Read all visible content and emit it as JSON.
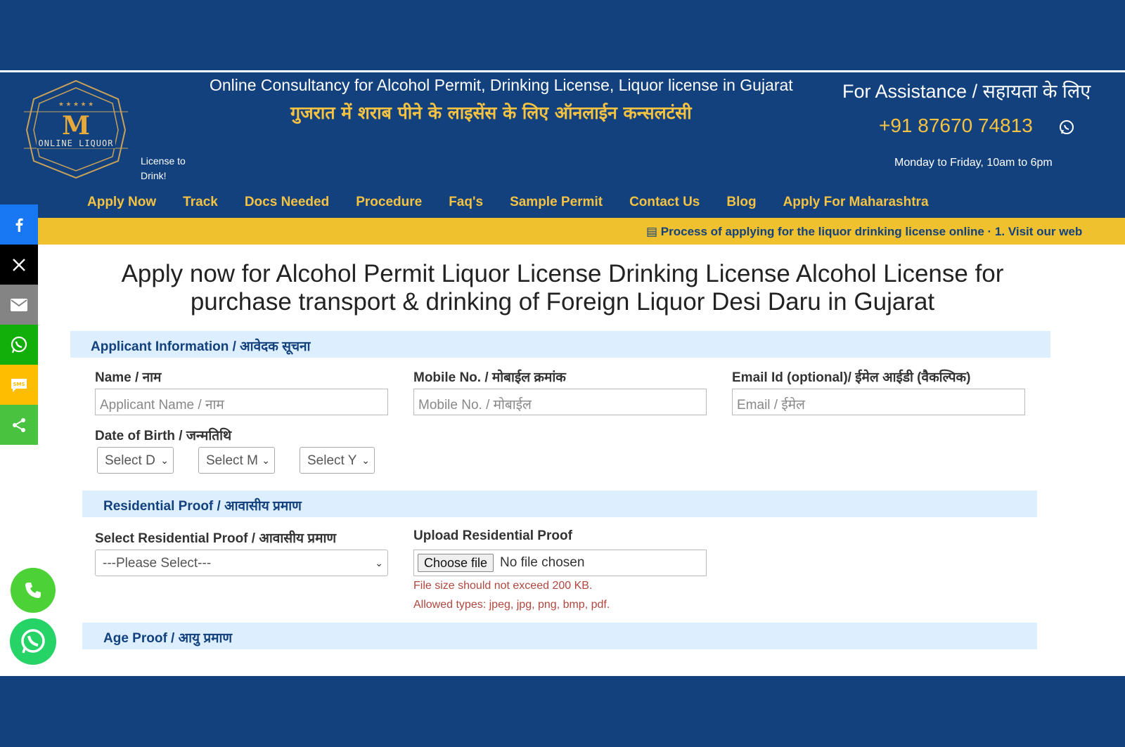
{
  "header": {
    "logo_text": "ONLINE LIQUOR",
    "logo_tagline": "License to Drink!",
    "tagline_en": "Online Consultancy for Alcohol Permit, Drinking License, Liquor license in Gujarat",
    "tagline_hi": "गुजरात में शराब पीने के लाइसेंस के लिए ऑनलाईन कन्सलटंसी",
    "assist_title": "For Assistance / सहायता के लिए",
    "assist_phone": "+91 87670 74813",
    "assist_hours": "Monday to Friday, 10am to 6pm"
  },
  "nav": {
    "items": [
      "Apply Now",
      "Track",
      "Docs Needed",
      "Procedure",
      "Faq's",
      "Sample Permit",
      "Contact Us",
      "Blog",
      "Apply For Maharashtra"
    ]
  },
  "ticker": {
    "text": "Process of applying for the liquor drinking license online · 1. Visit our web"
  },
  "share": {
    "icons": [
      "facebook-icon",
      "x-icon",
      "email-icon",
      "whatsapp-icon",
      "sms-icon",
      "share-icon"
    ]
  },
  "main": {
    "title": "Apply now for Alcohol Permit Liquor License Drinking License Alcohol License for purchase transport & drinking of Foreign Liquor Desi Daru in Gujarat"
  },
  "applicant": {
    "section_title": "Applicant Information / आवेदक सूचना",
    "name_label": "Name / नाम",
    "name_placeholder": "Applicant Name / नाम",
    "mobile_label": "Mobile No. / मोबाईल क्रमांक",
    "mobile_placeholder": "Mobile No. / मोबाईल",
    "email_label": "Email Id (optional)/ ईमेल आईडी (वैकल्पिक)",
    "email_placeholder": "Email / ईमेल",
    "dob_label": "Date of Birth / जन्मतिथि",
    "dob_day": "Select D",
    "dob_month": "Select M",
    "dob_year": "Select Y"
  },
  "residential": {
    "section_title": "Residential Proof / आवासीय प्रमाण",
    "select_label": "Select Residential Proof / आवासीय प्रमाण",
    "select_value": "---Please Select---",
    "upload_label": "Upload Residential Proof",
    "file_button": "Choose file",
    "file_status": "No file chosen",
    "hint_size": "File size should not exceed 200 KB.",
    "hint_types": "Allowed types: jpeg, jpg, png, bmp, pdf."
  },
  "age": {
    "section_title": "Age Proof / आयु प्रमाण"
  },
  "colors": {
    "brand_blue": "#12417e",
    "accent_gold": "#f5c242",
    "ticker_bg": "#efc12f",
    "section_bg": "#ddeeff",
    "hint_red": "#b0473e"
  }
}
